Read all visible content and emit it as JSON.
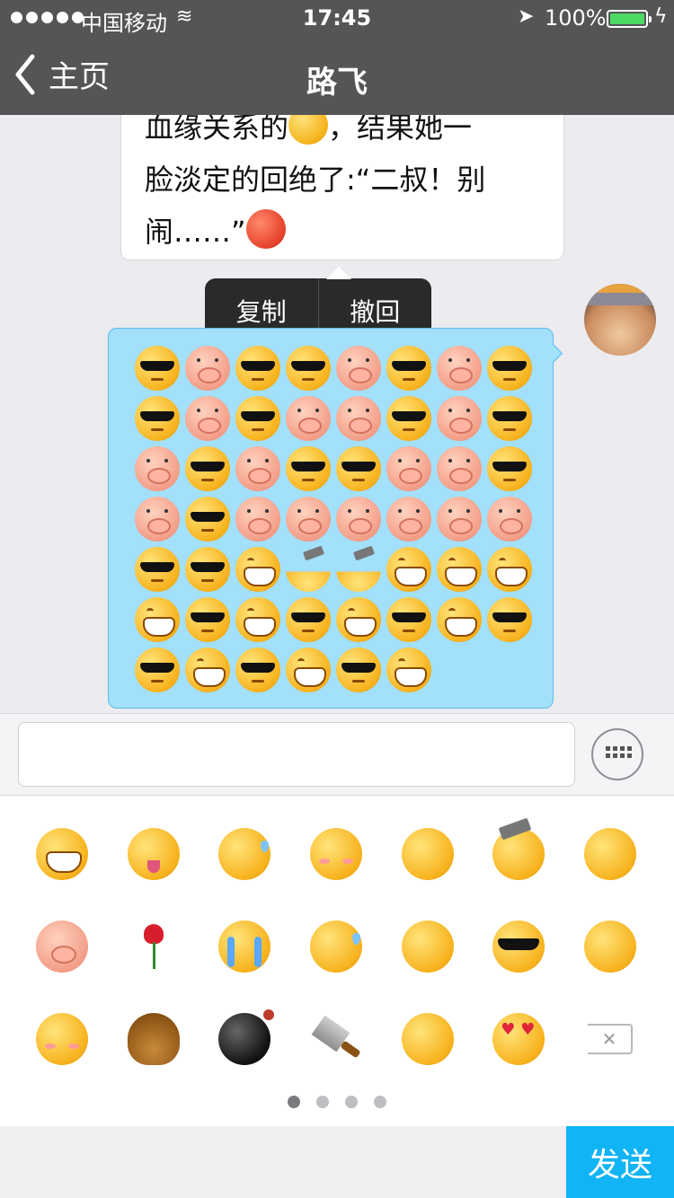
{
  "status_bar": {
    "carrier": "中国移动",
    "time": "17:45",
    "battery": "100%"
  },
  "nav": {
    "back_label": "主页",
    "title": "路飞"
  },
  "messages": {
    "incoming_text_line1": "血缘关系的",
    "incoming_text_line1b": "，结果她一",
    "incoming_text_line2": "脸淡定的回绝了:“二叔！别",
    "incoming_text_line3": "闹……”"
  },
  "context_menu": {
    "copy": "复制",
    "recall": "撤回"
  },
  "outgoing_emoji_grid": [
    [
      "cool",
      "pig",
      "cool",
      "cool",
      "pig",
      "cool",
      "pig",
      "cool"
    ],
    [
      "cool",
      "pig",
      "cool",
      "pig",
      "pig",
      "cool",
      "pig",
      "cool"
    ],
    [
      "pig",
      "cool",
      "pig",
      "cool",
      "cool",
      "pig",
      "pig",
      "cool"
    ],
    [
      "pig",
      "cool",
      "pig",
      "pig",
      "pig",
      "pig",
      "pig",
      "pig"
    ],
    [
      "cool",
      "cool",
      "grin",
      "hammer",
      "hammer",
      "grin",
      "grin",
      "grin"
    ],
    [
      "grin",
      "cool",
      "grin",
      "cool",
      "grin",
      "cool",
      "grin",
      "cool"
    ],
    [
      "cool",
      "grin",
      "cool",
      "grin",
      "cool",
      "grin"
    ]
  ],
  "input": {
    "value": "",
    "placeholder": ""
  },
  "emoji_panel": [
    [
      "grin",
      "wink",
      "sweat",
      "shy",
      "think",
      "hammer",
      "sweat-faint"
    ],
    [
      "pig",
      "rose",
      "cry",
      "sweat",
      "shh",
      "cool",
      "laugh"
    ],
    [
      "shy",
      "poop",
      "bomb",
      "knife",
      "smile",
      "love",
      "delete"
    ]
  ],
  "page_dots": {
    "count": 4,
    "active": 0
  },
  "send_label": "发送",
  "colors": {
    "nav_bg": "#555555",
    "bubble_out": "#a2e0fb",
    "send_bg": "#11b4f5",
    "battery": "#4cd964"
  }
}
